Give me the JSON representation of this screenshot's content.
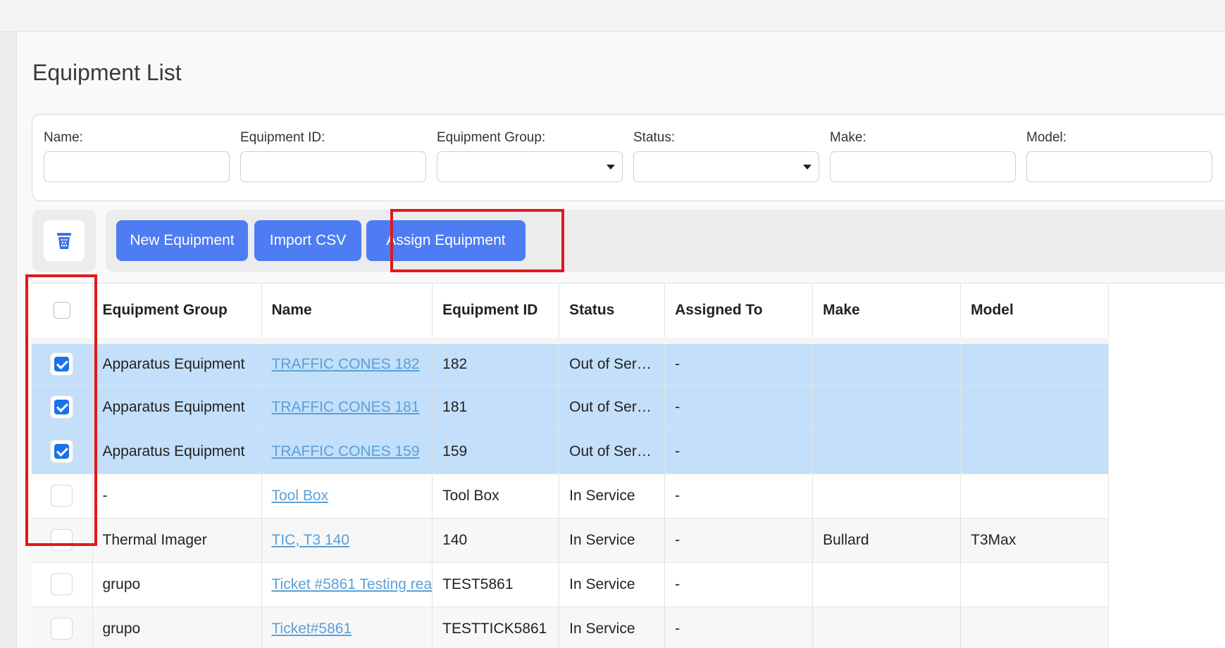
{
  "page": {
    "title": "Equipment List"
  },
  "filters": [
    {
      "label": "Name:",
      "type": "text"
    },
    {
      "label": "Equipment ID:",
      "type": "text"
    },
    {
      "label": "Equipment Group:",
      "type": "select"
    },
    {
      "label": "Status:",
      "type": "select"
    },
    {
      "label": "Make:",
      "type": "text"
    },
    {
      "label": "Model:",
      "type": "text"
    }
  ],
  "toolbar": {
    "delete_icon": "trash-icon",
    "new_label": "New Equipment",
    "import_label": "Import CSV",
    "assign_label": "Assign Equipment"
  },
  "colors": {
    "accent": "#4d7cf3",
    "highlight": "#e0191b",
    "selected_row": "#c4dff9",
    "link": "#5aa0d8"
  },
  "table": {
    "columns": [
      "Equipment Group",
      "Name",
      "Equipment ID",
      "Status",
      "Assigned To",
      "Make",
      "Model"
    ],
    "rows": [
      {
        "checked": true,
        "group": "Apparatus Equipment",
        "name": "TRAFFIC CONES 182",
        "id": "182",
        "status": "Out of Ser…",
        "assigned": "-",
        "make": "",
        "model": ""
      },
      {
        "checked": true,
        "group": "Apparatus Equipment",
        "name": "TRAFFIC CONES 181",
        "id": "181",
        "status": "Out of Ser…",
        "assigned": "-",
        "make": "",
        "model": ""
      },
      {
        "checked": true,
        "group": "Apparatus Equipment",
        "name": "TRAFFIC CONES 159",
        "id": "159",
        "status": "Out of Ser…",
        "assigned": "-",
        "make": "",
        "model": ""
      },
      {
        "checked": false,
        "group": "-",
        "name": "Tool Box",
        "id": "Tool Box",
        "status": "In Service",
        "assigned": "-",
        "make": "",
        "model": ""
      },
      {
        "checked": false,
        "group": "Thermal Imager",
        "name": "TIC, T3 140",
        "id": "140",
        "status": "In Service",
        "assigned": "-",
        "make": "Bullard",
        "model": "T3Max"
      },
      {
        "checked": false,
        "group": "grupo",
        "name": "Ticket #5861 Testing rea",
        "id": "TEST5861",
        "status": "In Service",
        "assigned": "-",
        "make": "",
        "model": ""
      },
      {
        "checked": false,
        "group": "grupo",
        "name": "Ticket#5861",
        "id": "TESTTICK5861",
        "status": "In Service",
        "assigned": "-",
        "make": "",
        "model": ""
      }
    ]
  }
}
